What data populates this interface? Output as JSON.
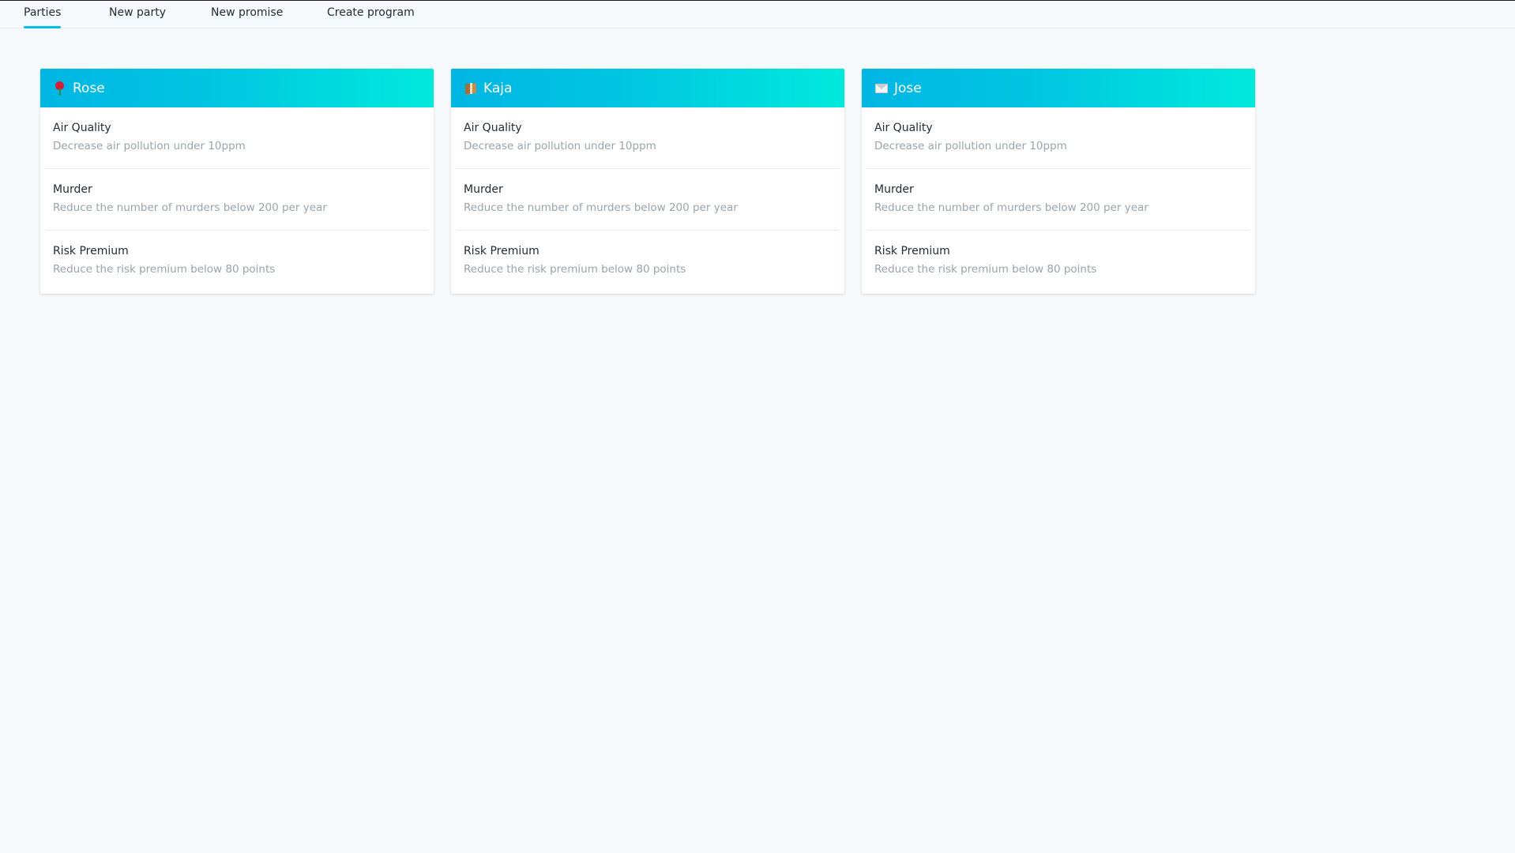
{
  "nav": {
    "tabs": [
      {
        "label": "Parties",
        "active": true
      },
      {
        "label": "New party",
        "active": false
      },
      {
        "label": "New promise",
        "active": false
      },
      {
        "label": "Create program",
        "active": false
      }
    ]
  },
  "colors": {
    "accent": "#00bfe6",
    "header_gradient_start": "#00b6e3",
    "header_gradient_end": "#00eadc",
    "background": "#f6f9fc",
    "muted_text": "#9aa3ab"
  },
  "parties": [
    {
      "icon": "rose-icon",
      "name": "Rose",
      "promises": [
        {
          "title": "Air Quality",
          "description": "Decrease air pollution under 10ppm"
        },
        {
          "title": "Murder",
          "description": "Reduce the number of murders below 200 per year"
        },
        {
          "title": "Risk Premium",
          "description": "Reduce the risk premium below 80 points"
        }
      ]
    },
    {
      "icon": "package-icon",
      "name": "Kaja",
      "promises": [
        {
          "title": "Air Quality",
          "description": "Decrease air pollution under 10ppm"
        },
        {
          "title": "Murder",
          "description": "Reduce the number of murders below 200 per year"
        },
        {
          "title": "Risk Premium",
          "description": "Reduce the risk premium below 80 points"
        }
      ]
    },
    {
      "icon": "envelope-icon",
      "name": "Jose",
      "promises": [
        {
          "title": "Air Quality",
          "description": "Decrease air pollution under 10ppm"
        },
        {
          "title": "Murder",
          "description": "Reduce the number of murders below 200 per year"
        },
        {
          "title": "Risk Premium",
          "description": "Reduce the risk premium below 80 points"
        }
      ]
    }
  ]
}
